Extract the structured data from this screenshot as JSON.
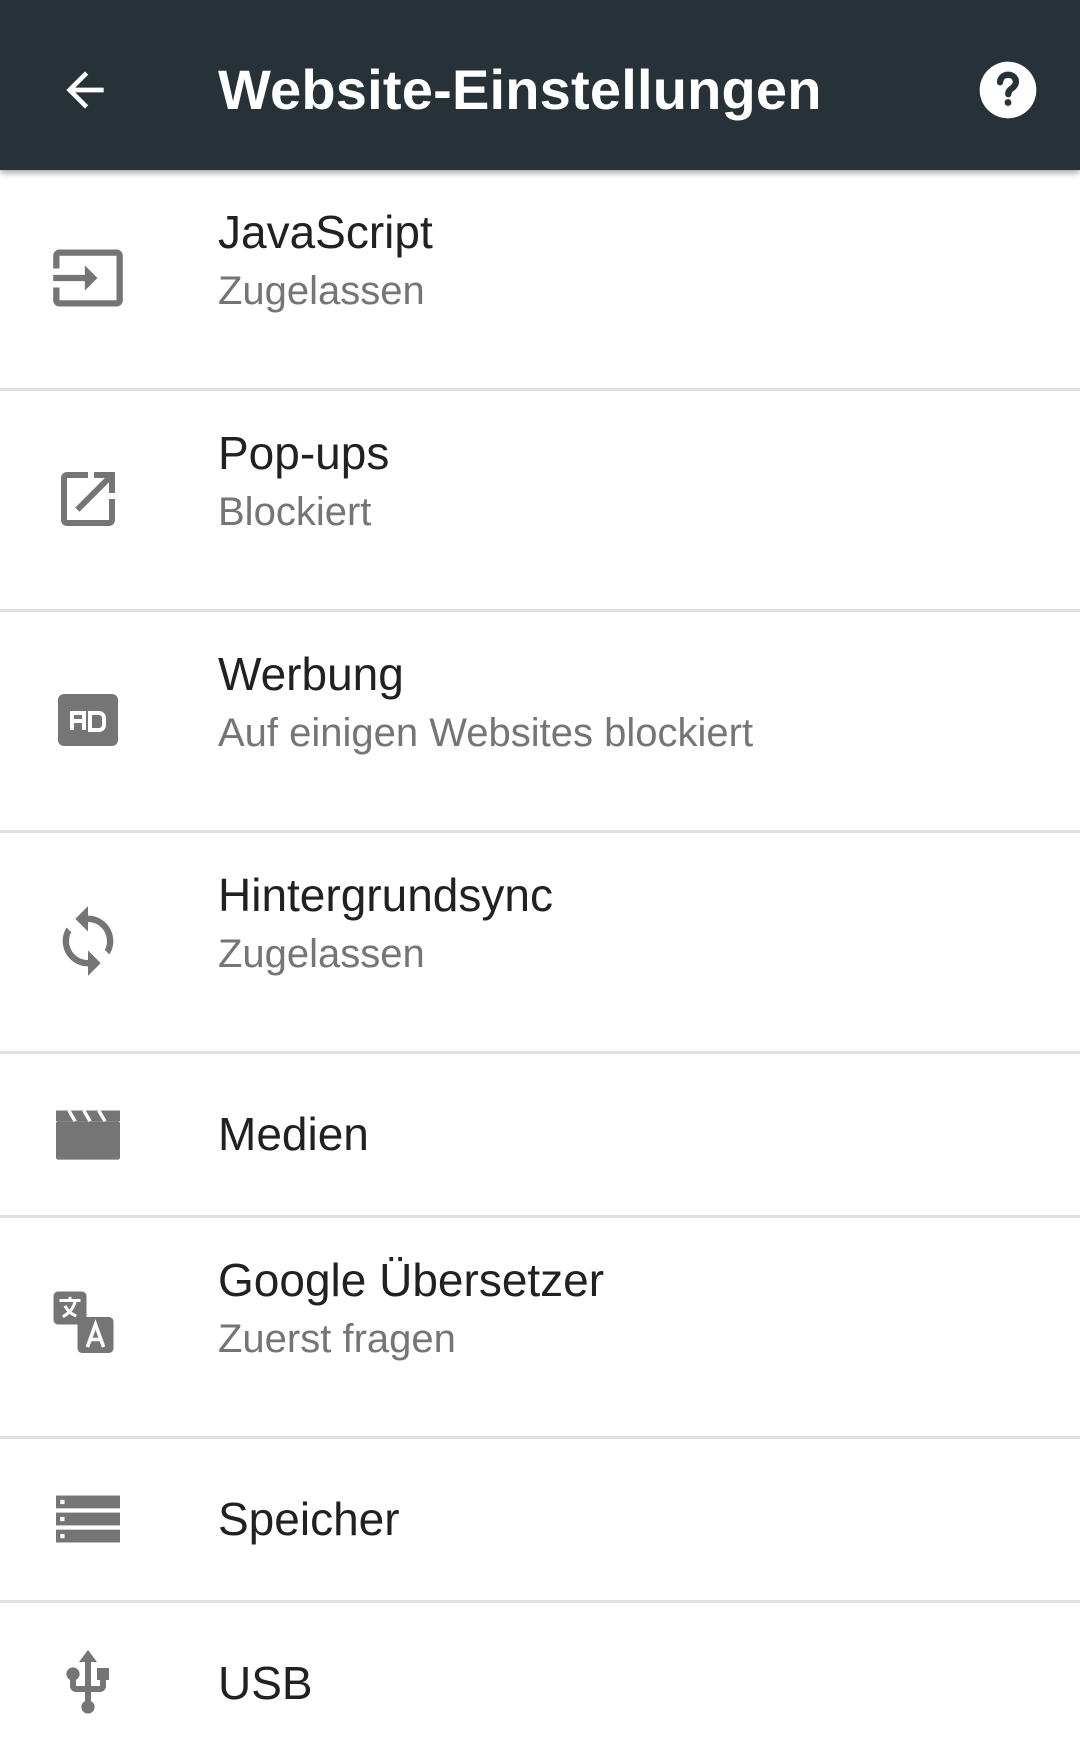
{
  "header": {
    "title": "Website-Einstellungen",
    "back_icon": "arrow-back-icon",
    "help_icon": "help-icon",
    "background_color": "#263238"
  },
  "items": [
    {
      "icon": "javascript-icon",
      "label": "JavaScript",
      "status": "Zugelassen"
    },
    {
      "icon": "open-in-new-icon",
      "label": "Pop-ups",
      "status": "Blockiert"
    },
    {
      "icon": "ad-icon",
      "label": "Werbung",
      "status": "Auf einigen Websites blockiert"
    },
    {
      "icon": "sync-icon",
      "label": "Hintergrundsync",
      "status": "Zugelassen"
    },
    {
      "icon": "clapperboard-icon",
      "label": "Medien"
    },
    {
      "icon": "translate-icon",
      "label": "Google Übersetzer",
      "status": "Zuerst fragen"
    },
    {
      "icon": "storage-icon",
      "label": "Speicher"
    },
    {
      "icon": "usb-icon",
      "label": "USB"
    }
  ],
  "colors": {
    "icon_gray": "#757575",
    "primary_text": "#212121",
    "secondary_text": "#757575",
    "divider": "#e0e0e0"
  }
}
